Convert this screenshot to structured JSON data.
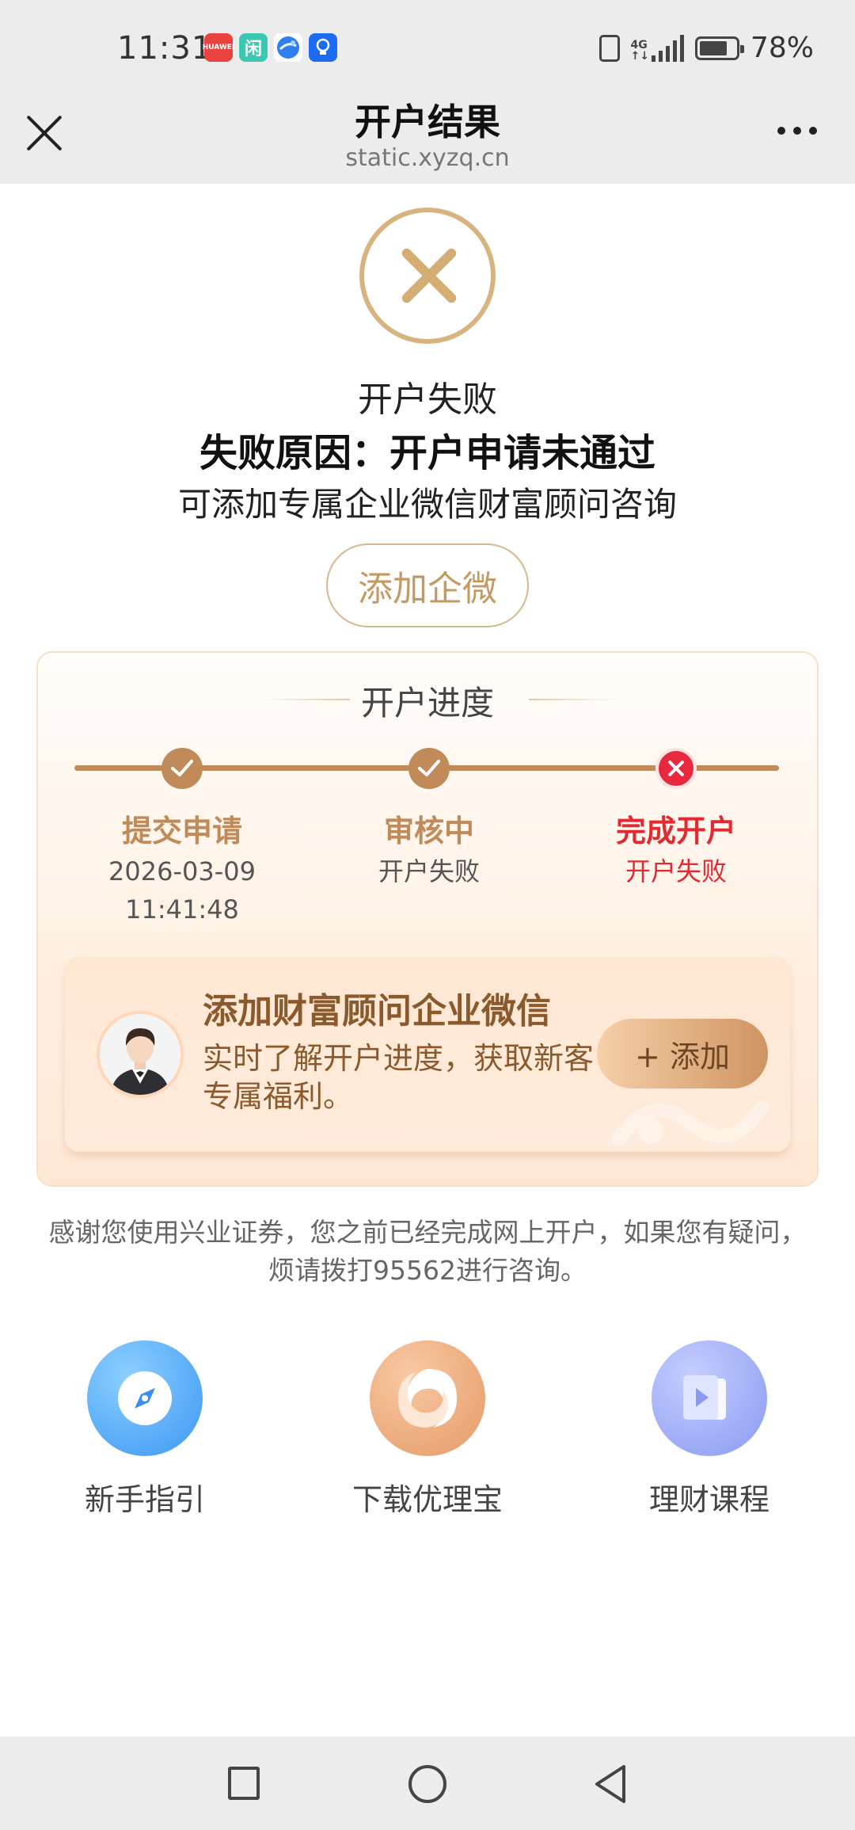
{
  "status_bar": {
    "time": "11:31",
    "battery": "78%",
    "battery_level": 0.78,
    "notification_icons": [
      "huawei-appgallery-icon",
      "xianyu-icon",
      "browser-icon",
      "lightbulb-icon"
    ]
  },
  "header": {
    "title": "开户结果",
    "domain": "static.xyzq.cn"
  },
  "result": {
    "title": "开户失败",
    "reason": "失败原因：开户申请未通过",
    "tip": "可添加专属企业微信财富顾问咨询",
    "button": "添加企微"
  },
  "progress": {
    "title": "开户进度",
    "steps": [
      {
        "label": "提交申请",
        "sub1": "2026-03-09",
        "sub2": "11:41:48",
        "status": "done"
      },
      {
        "label": "审核中",
        "sub1": "开户失败",
        "status": "done"
      },
      {
        "label": "完成开户",
        "sub1": "开户失败",
        "status": "failed"
      }
    ]
  },
  "advisor": {
    "title": "添加财富顾问企业微信",
    "desc": "实时了解开户进度，获取新客专属福利。",
    "button": "+ 添加"
  },
  "note": "感谢您使用兴业证券，您之前已经完成网上开户，如果您有疑问，烦请拨打95562进行咨询。",
  "shortcuts": [
    {
      "label": "新手指引",
      "icon": "compass-icon"
    },
    {
      "label": "下载优理宝",
      "icon": "app-logo-icon"
    },
    {
      "label": "理财课程",
      "icon": "video-course-icon"
    }
  ],
  "colors": {
    "gold": "#c08a59",
    "fail_red": "#e22a33"
  }
}
